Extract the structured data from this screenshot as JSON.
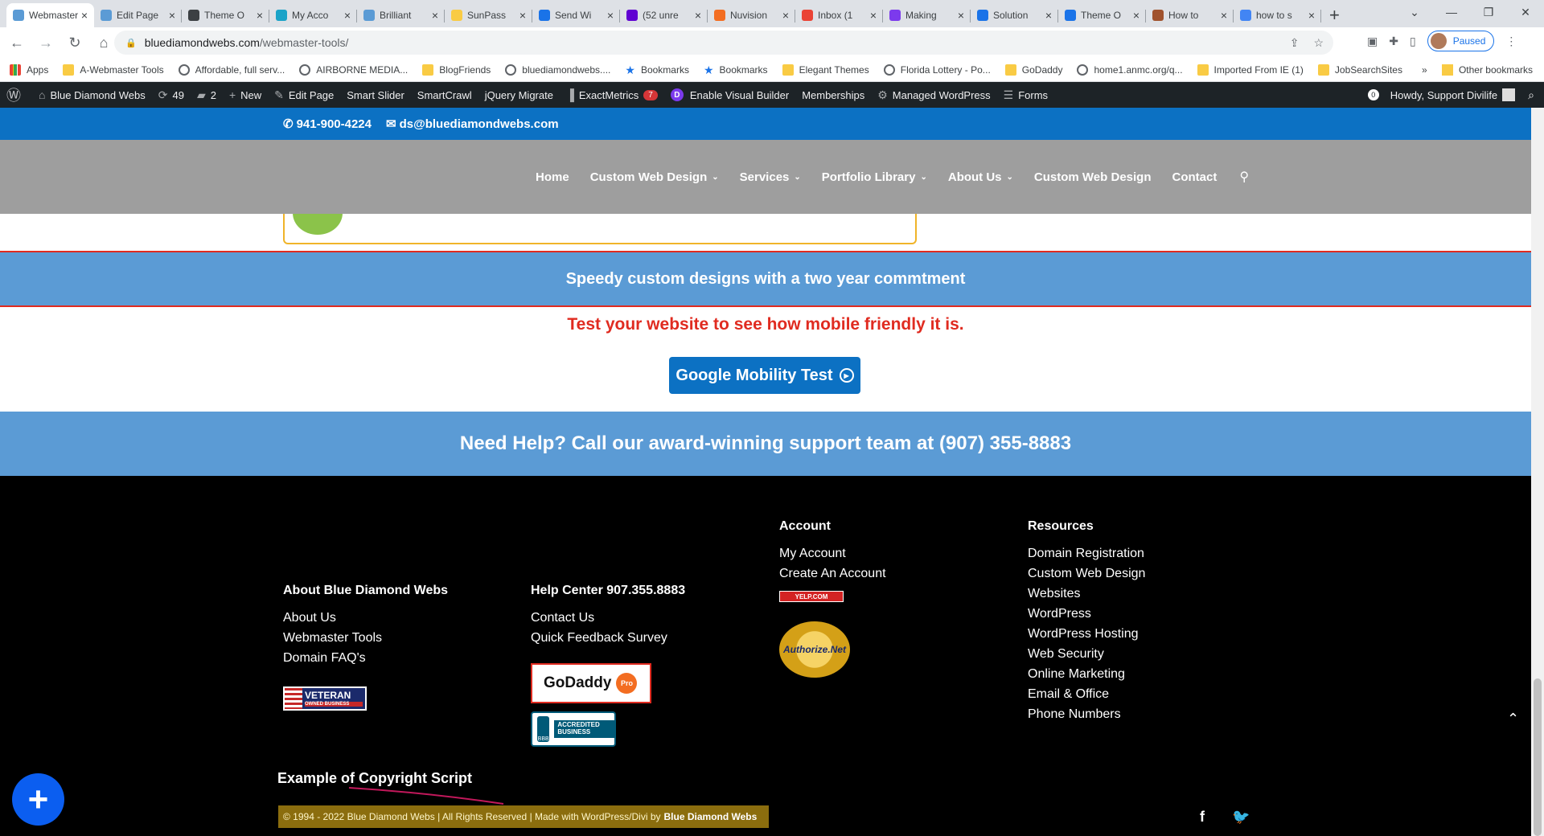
{
  "browser": {
    "tabs": [
      {
        "title": "Webmaster",
        "color": "#5b9bd5",
        "active": true
      },
      {
        "title": "Edit Page",
        "color": "#5b9bd5"
      },
      {
        "title": "Theme O",
        "color": "#3c4043"
      },
      {
        "title": "My Acco",
        "color": "#1aa3c8"
      },
      {
        "title": "Brilliant",
        "color": "#5b9bd5"
      },
      {
        "title": "SunPass",
        "color": "#f9cb44"
      },
      {
        "title": "Send Wi",
        "color": "#1a73e8"
      },
      {
        "title": "(52 unre",
        "color": "#6001d2"
      },
      {
        "title": "Nuvision",
        "color": "#f36d21"
      },
      {
        "title": "Inbox (1",
        "color": "#ea4335"
      },
      {
        "title": "Making",
        "color": "#7c3aed"
      },
      {
        "title": "Solution",
        "color": "#1a73e8"
      },
      {
        "title": "Theme O",
        "color": "#1a73e8"
      },
      {
        "title": "How to",
        "color": "#a0522d"
      },
      {
        "title": "how to s",
        "color": "#4285f4"
      }
    ],
    "url_host": "bluediamondwebs.com",
    "url_path": "/webmaster-tools/",
    "profile_status": "Paused"
  },
  "bookmarks": [
    {
      "label": "Apps",
      "type": "apps"
    },
    {
      "label": "A-Webmaster Tools",
      "type": "folder"
    },
    {
      "label": "Affordable, full serv...",
      "type": "globe"
    },
    {
      "label": "AIRBORNE MEDIA...",
      "type": "globe"
    },
    {
      "label": "BlogFriends",
      "type": "folder"
    },
    {
      "label": "bluediamondwebs....",
      "type": "globe"
    },
    {
      "label": "Bookmarks",
      "type": "star"
    },
    {
      "label": "Bookmarks",
      "type": "star"
    },
    {
      "label": "Elegant Themes",
      "type": "folder"
    },
    {
      "label": "Florida Lottery - Po...",
      "type": "globe"
    },
    {
      "label": "GoDaddy",
      "type": "folder"
    },
    {
      "label": "home1.anmc.org/q...",
      "type": "globe"
    },
    {
      "label": "Imported From IE (1)",
      "type": "folder"
    },
    {
      "label": "JobSearchSites",
      "type": "folder"
    }
  ],
  "bookmarks_more": "»",
  "bookmarks_other": "Other bookmarks",
  "wpbar": {
    "site_name": "Blue Diamond Webs",
    "updates": "49",
    "comments": "2",
    "new": "New",
    "edit_page": "Edit Page",
    "smart_slider": "Smart Slider",
    "smartcrawl": "SmartCrawl",
    "jquery": "jQuery Migrate",
    "exactmetrics": "ExactMetrics",
    "exactmetrics_badge": "7",
    "visual_builder": "Enable Visual Builder",
    "memberships": "Memberships",
    "managed_wp": "Managed WordPress",
    "forms": "Forms",
    "notif_count": "0",
    "howdy": "Howdy, Support Divilife"
  },
  "site": {
    "phone": "941-900-4224",
    "email": "ds@bluediamondwebs.com",
    "nav": [
      {
        "label": "Home",
        "dropdown": false
      },
      {
        "label": "Custom Web Design",
        "dropdown": true
      },
      {
        "label": "Services",
        "dropdown": true
      },
      {
        "label": "Portfolio Library",
        "dropdown": true
      },
      {
        "label": "About Us",
        "dropdown": true
      },
      {
        "label": "Custom Web Design",
        "dropdown": false
      },
      {
        "label": "Contact",
        "dropdown": false
      }
    ],
    "band1_text": "Speedy custom designs with a two year commtment",
    "test_text": "Test your website to see how mobile friendly it is.",
    "mobility_button": "Google Mobility Test",
    "band2_text": "Need Help? Call our award-winning support team at (907) 355-8883"
  },
  "footer": {
    "about_title": "About Blue Diamond Webs",
    "about_links": [
      "About Us",
      "Webmaster Tools",
      "Domain FAQ's"
    ],
    "veteran_badge": "VETERAN",
    "veteran_sub": "OWNED BUSINESS",
    "help_title": "Help Center 907.355.8883",
    "help_links": [
      "Contact Us",
      "Quick Feedback Survey"
    ],
    "godaddy_badge": "GoDaddy",
    "godaddy_pro": "Pro",
    "bbb_badge": "ACCREDITED BUSINESS",
    "bbb_label": "BBB",
    "account_title": "Account",
    "account_links": [
      "My Account",
      "Create An Account"
    ],
    "yelp_badge": "YELP.COM",
    "authnet_badge": "Authorize.Net",
    "resources_title": "Resources",
    "resources_links": [
      "Domain Registration",
      "Custom Web Design",
      "Websites",
      "WordPress",
      "WordPress Hosting",
      "Web Security",
      "Online Marketing",
      "Email & Office",
      "Phone Numbers"
    ],
    "copyright_label": "Example of Copyright Script",
    "copyright_text": "© 1994 - 2022 Blue Diamond Webs | All Rights Reserved | Made with WordPress/Divi by",
    "copyright_brand": "Blue Diamond Webs"
  }
}
